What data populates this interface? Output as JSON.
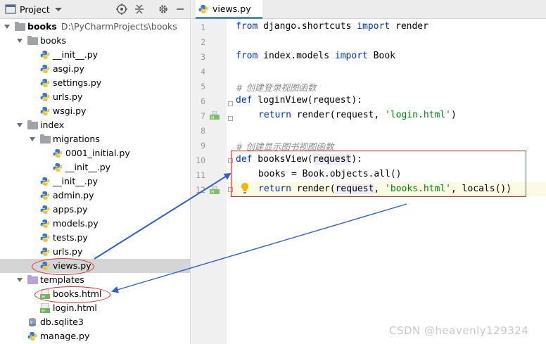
{
  "project": {
    "title": "Project",
    "rows": [
      {
        "label": "books",
        "path": "D:\\PyCharmProjects\\books",
        "kind": "root"
      },
      {
        "label": "books",
        "kind": "folder"
      },
      {
        "label": "__init__.py",
        "kind": "py"
      },
      {
        "label": "asgi.py",
        "kind": "py"
      },
      {
        "label": "settings.py",
        "kind": "py"
      },
      {
        "label": "urls.py",
        "kind": "py"
      },
      {
        "label": "wsgi.py",
        "kind": "py"
      },
      {
        "label": "index",
        "kind": "folder"
      },
      {
        "label": "migrations",
        "kind": "folder"
      },
      {
        "label": "0001_initial.py",
        "kind": "py"
      },
      {
        "label": "__init__.py",
        "kind": "py"
      },
      {
        "label": "__init__.py",
        "kind": "py"
      },
      {
        "label": "admin.py",
        "kind": "py"
      },
      {
        "label": "apps.py",
        "kind": "py"
      },
      {
        "label": "models.py",
        "kind": "py"
      },
      {
        "label": "tests.py",
        "kind": "py"
      },
      {
        "label": "urls.py",
        "kind": "py"
      },
      {
        "label": "views.py",
        "kind": "py",
        "selected": true
      },
      {
        "label": "templates",
        "kind": "folder"
      },
      {
        "label": "books.html",
        "kind": "html"
      },
      {
        "label": "login.html",
        "kind": "html"
      },
      {
        "label": "db.sqlite3",
        "kind": "db"
      },
      {
        "label": "manage.py",
        "kind": "py"
      }
    ]
  },
  "editor": {
    "tab_label": "views.py",
    "line_numbers": [
      "1",
      "2",
      "3",
      "4",
      "5",
      "6",
      "7",
      "8",
      "9",
      "10",
      "11",
      "12"
    ],
    "code": {
      "l1_from": "from",
      "l1_mod": " django.shortcuts ",
      "l1_import": "import",
      "l1_name": " render",
      "l3_from": "from",
      "l3_mod": " index.models ",
      "l3_import": "import",
      "l3_name": " Book",
      "l5_comment": "# 创建登录视图函数",
      "l6_def": "def",
      "l6_rest": " loginView(request):",
      "l7_return": "return",
      "l7_mid": " render(request, ",
      "l7_str": "'login.html'",
      "l7_end": ")",
      "l9_comment": "# 创建显示图书视图函数",
      "l10_def": "def",
      "l10_a": " booksView(",
      "l10_param": "request",
      "l10_b": "):",
      "l11": "books = Book.objects.all()",
      "l12_return": "return",
      "l12_a": " render(",
      "l12_param": "request",
      "l12_b": ", ",
      "l12_str": "'books.html'",
      "l12_c": ", locals())"
    }
  },
  "watermark": "CSDN @heavenly129324",
  "colors": {
    "keyword": "#0033b3",
    "string": "#067d17",
    "comment": "#8c8c8c",
    "annotation": "#e02b2b",
    "arrow": "#2f5fc8",
    "selection": "#d5d5d5"
  }
}
